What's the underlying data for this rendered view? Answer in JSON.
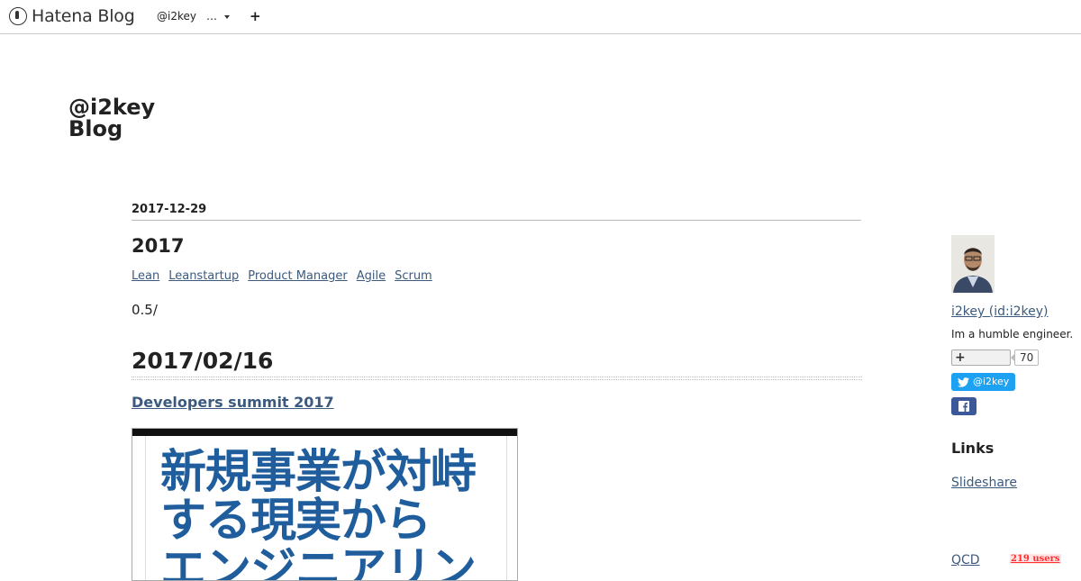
{
  "topbar": {
    "logo_text": "Hatena Blog",
    "user_name": "@i2key",
    "menu_label": "…",
    "add_label": "+"
  },
  "blog": {
    "title_line1": "@i2key",
    "title_line2": "Blog"
  },
  "entry": {
    "date": "2017-12-29",
    "title": "2017",
    "categories": [
      "Lean",
      "Leanstartup",
      "Product Manager",
      "Agile",
      "Scrum"
    ],
    "intro": "0.5/",
    "section_title": "2017/02/16",
    "link_title": "Developers summit 2017",
    "slide_text": "新規事業が対峙\nする現実から\nエンジニアリン"
  },
  "sidebar": {
    "profile_name": "i2key (id:i2key)",
    "profile_desc": "Im a humble engineer.",
    "follow_count": "70",
    "twitter_label": "@i2key",
    "links_title": "Links",
    "links": [
      {
        "label": "Slideshare"
      },
      {
        "label": "QCD",
        "users": "219 users"
      }
    ]
  },
  "colors": {
    "link": "#3c5a7d",
    "twitter": "#1da1f2",
    "facebook": "#3b5998",
    "slide_text": "#1f5d9c",
    "users_badge": "#ff2f2f"
  }
}
